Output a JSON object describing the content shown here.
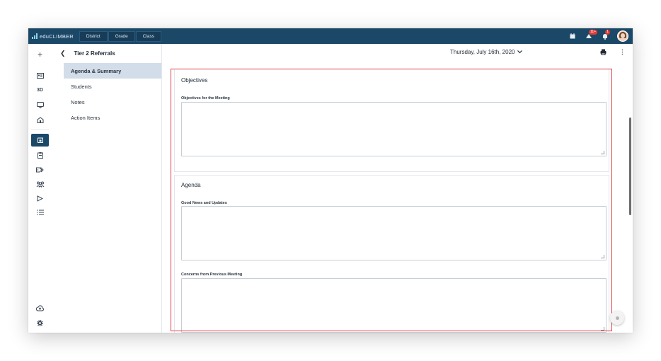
{
  "app": {
    "brand": "eduCLIMBER",
    "nav_tabs": [
      "District",
      "Grade",
      "Class"
    ],
    "notifications": {
      "messages_badge": "11+",
      "alerts_badge": "1"
    }
  },
  "header": {
    "page_title": "Tier 2 Referrals",
    "date": "Thursday, July 16th, 2020"
  },
  "subnav": {
    "items": [
      {
        "label": "Agenda & Summary",
        "active": true
      },
      {
        "label": "Students"
      },
      {
        "label": "Notes"
      },
      {
        "label": "Action Items"
      }
    ]
  },
  "rail": {
    "icons": [
      "add-icon",
      "profile-card-icon",
      "3d-icon",
      "chat-icon",
      "school-icon",
      "calendar-icon",
      "clipboard-icon",
      "tags-icon",
      "group-icon",
      "flag-icon",
      "list-icon",
      "upload-cloud-icon",
      "settings-icon"
    ],
    "three_d_label": "3D"
  },
  "content": {
    "objectives": {
      "title": "Objectives",
      "field_label": "Objectives for the Meeting"
    },
    "agenda": {
      "title": "Agenda",
      "field1_label": "Good News and Updates",
      "field2_label": "Concerns from Previous Meeting"
    }
  },
  "colors": {
    "topbar": "#1c4868",
    "highlight": "#e53945",
    "active_nav": "#d2dde9"
  }
}
